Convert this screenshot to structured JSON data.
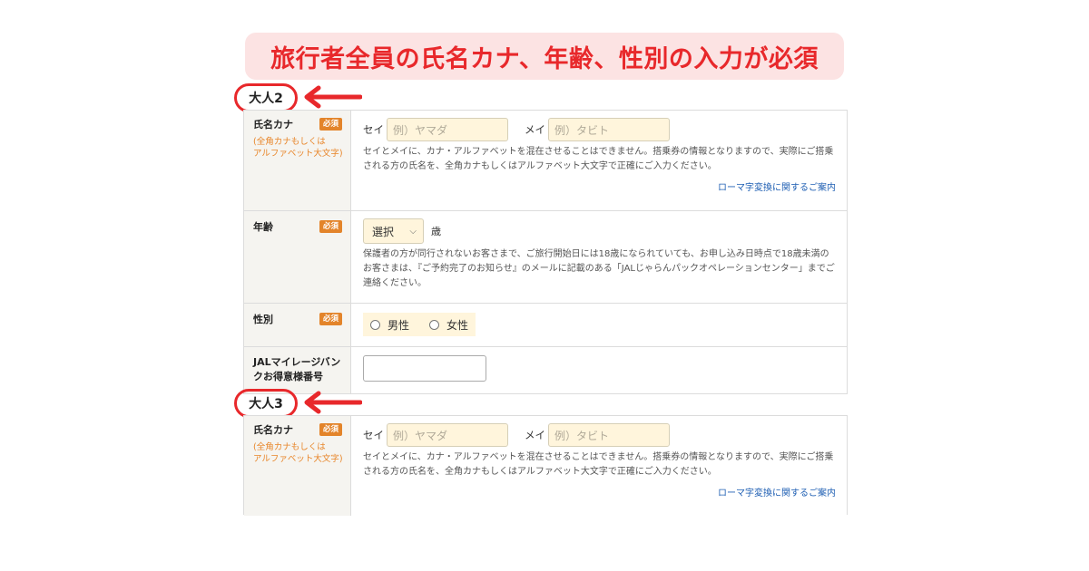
{
  "banner": {
    "text": "旅行者全員の氏名カナ、年齢、性別の入力が必須"
  },
  "colors": {
    "accent_red": "#e8282b",
    "banner_bg": "#fce3e3",
    "badge_orange": "#e3842a",
    "input_bg": "#fff5dc",
    "link_blue": "#1f5fb3"
  },
  "icons": {
    "arrow": "left-arrow-icon"
  },
  "adult2": {
    "label": "大人2",
    "name": {
      "title": "氏名カナ",
      "badge": "必須",
      "sub": "(全角カナもしくは\nアルファベット大文字)",
      "sei_label": "セイ",
      "sei_placeholder": "例）ヤマダ",
      "mei_label": "メイ",
      "mei_placeholder": "例）タビト",
      "note": "セイとメイに、カナ・アルファベットを混在させることはできません。搭乗券の情報となりますので、実際にご搭乗される方の氏名を、全角カナもしくはアルファベット大文字で正確にご入力ください。",
      "link": "ローマ字変換に関するご案内"
    },
    "age": {
      "title": "年齢",
      "badge": "必須",
      "selected": "選択",
      "unit": "歳",
      "note": "保護者の方が同行されないお客さまで、ご旅行開始日には18歳になられていても、お申し込み日時点で18歳未満のお客さまは、『ご予約完了のお知らせ』のメールに記載のある「JALじゃらんパックオペレーションセンター」までご連絡ください。"
    },
    "gender": {
      "title": "性別",
      "badge": "必須",
      "option_male": "男性",
      "option_female": "女性"
    },
    "mileage": {
      "title": "JALマイレージバンクお得意様番号",
      "value": ""
    }
  },
  "adult3": {
    "label": "大人3",
    "name": {
      "title": "氏名カナ",
      "badge": "必須",
      "sub": "(全角カナもしくは\nアルファベット大文字)",
      "sei_label": "セイ",
      "sei_placeholder": "例）ヤマダ",
      "mei_label": "メイ",
      "mei_placeholder": "例）タビト",
      "note": "セイとメイに、カナ・アルファベットを混在させることはできません。搭乗券の情報となりますので、実際にご搭乗される方の氏名を、全角カナもしくはアルファベット大文字で正確にご入力ください。",
      "link": "ローマ字変換に関するご案内"
    }
  }
}
